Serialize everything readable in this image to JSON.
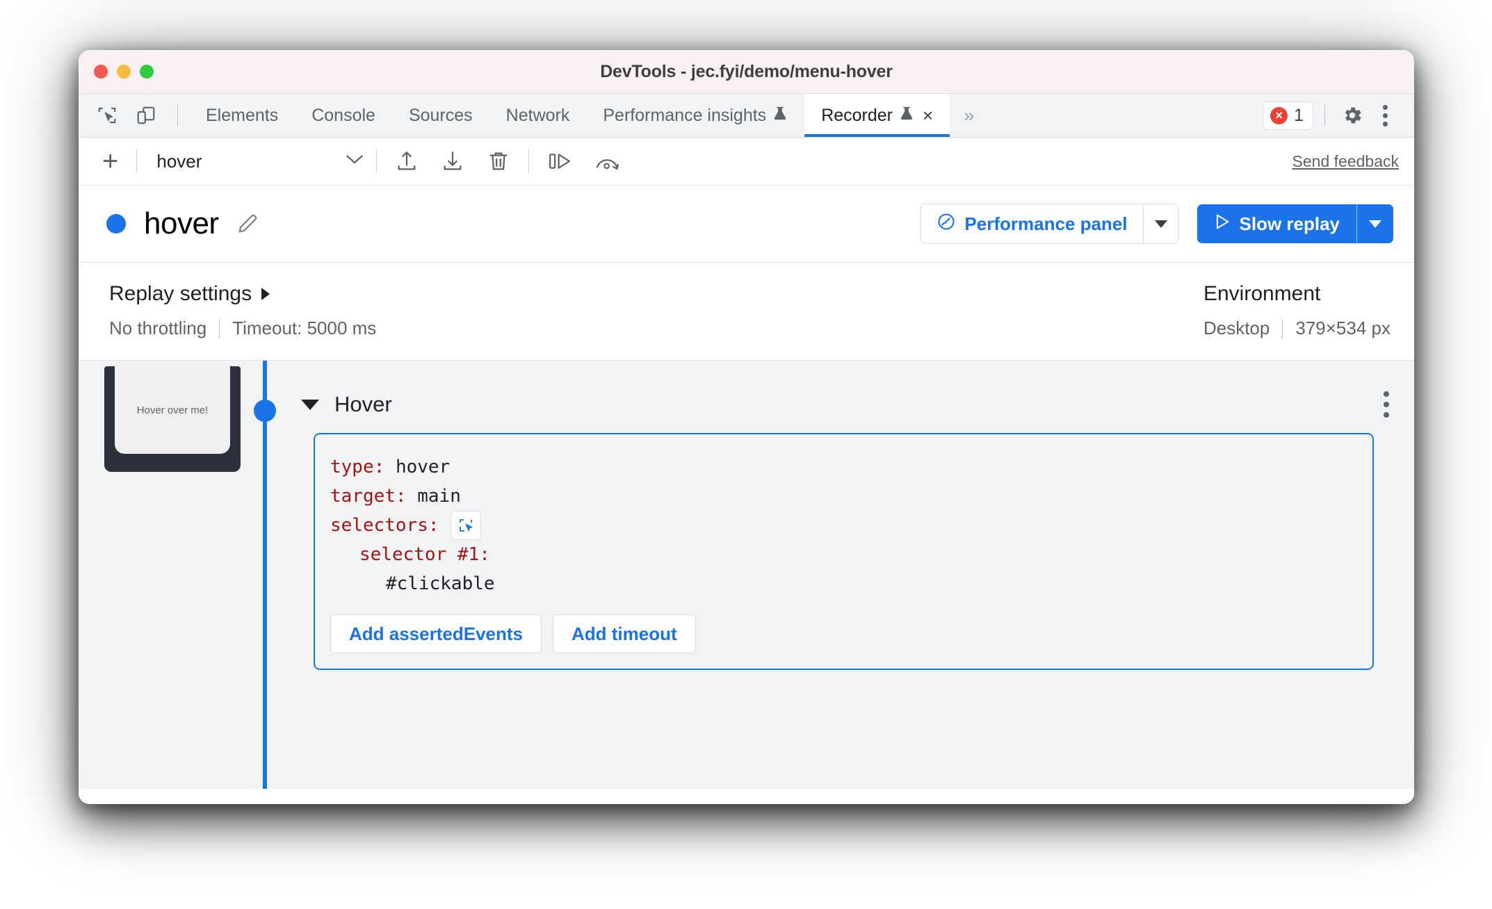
{
  "window": {
    "title": "DevTools - jec.fyi/demo/menu-hover",
    "traffic_lights": [
      "close",
      "minimize",
      "zoom"
    ]
  },
  "tabbar": {
    "inspect_icon": "inspect-element-icon",
    "device_icon": "device-toolbar-icon",
    "tabs": [
      {
        "label": "Elements",
        "active": false,
        "experimental": false,
        "closable": false
      },
      {
        "label": "Console",
        "active": false,
        "experimental": false,
        "closable": false
      },
      {
        "label": "Sources",
        "active": false,
        "experimental": false,
        "closable": false
      },
      {
        "label": "Network",
        "active": false,
        "experimental": false,
        "closable": false
      },
      {
        "label": "Performance insights",
        "active": false,
        "experimental": true,
        "closable": false
      },
      {
        "label": "Recorder",
        "active": true,
        "experimental": true,
        "closable": true
      }
    ],
    "overflow_label": "»",
    "close_glyph": "×",
    "error_badge": {
      "count": "1",
      "glyph": "×",
      "color": "#e94235"
    },
    "settings_icon": "gear-icon",
    "more_icon": "kebab-menu-icon"
  },
  "toolbar": {
    "add_label": "+",
    "recording_name": "hover",
    "dropdown_glyph": "⌄",
    "export_icon": "export-icon",
    "import_icon": "import-icon",
    "delete_icon": "trash-icon",
    "step_icon": "step-over-icon",
    "replay_icon": "replay-arc-icon",
    "feedback_label": "Send feedback"
  },
  "header": {
    "status_color": "#1a73e8",
    "recording_title": "hover",
    "edit_icon": "pencil-icon",
    "performance_button": {
      "label": "Performance panel",
      "icon": "performance-icon"
    },
    "replay_button": {
      "label": "Slow replay",
      "icon": "play-icon"
    }
  },
  "settings": {
    "replay_title": "Replay settings",
    "throttling": "No throttling",
    "timeout": "Timeout: 5000 ms",
    "environment_title": "Environment",
    "device": "Desktop",
    "viewport": "379×534 px"
  },
  "step": {
    "thumbnail_text": "Hover over me!",
    "title": "Hover",
    "code": [
      {
        "key": "type",
        "sep": ": ",
        "value": "hover",
        "indent": 0
      },
      {
        "key": "target",
        "sep": ": ",
        "value": "main",
        "indent": 0
      },
      {
        "key": "selectors",
        "sep": ":",
        "value": "",
        "indent": 0,
        "picker": "select-element-icon"
      },
      {
        "key": "selector #1",
        "sep": ":",
        "value": "",
        "indent": 1
      },
      {
        "key": "",
        "sep": "",
        "value": "#clickable",
        "indent": 2
      }
    ],
    "add_asserted_events_label": "Add assertedEvents",
    "add_timeout_label": "Add timeout",
    "more_icon": "kebab-menu-icon"
  }
}
